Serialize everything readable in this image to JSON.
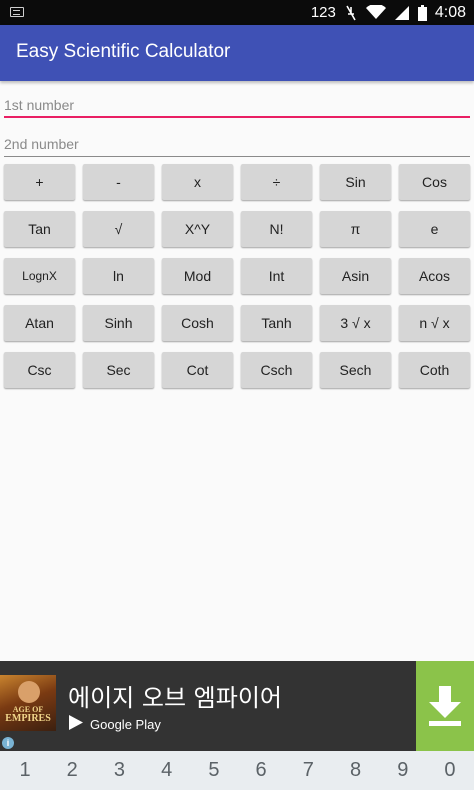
{
  "status_bar": {
    "network_label": "123",
    "clock": "4:08"
  },
  "app_bar": {
    "title": "Easy Scientific Calculator",
    "color": "#3f51b5"
  },
  "inputs": {
    "first": {
      "placeholder": "1st number",
      "value": ""
    },
    "second": {
      "placeholder": "2nd number",
      "value": ""
    },
    "accent": "#e91e63"
  },
  "keys": [
    "+",
    "-",
    "x",
    "÷",
    "Sin",
    "Cos",
    "Tan",
    "√",
    "X^Y",
    "N!",
    "π",
    "e",
    "LognX",
    "ln",
    "Mod",
    "Int",
    "Asin",
    "Acos",
    "Atan",
    "Sinh",
    "Cosh",
    "Tanh",
    "3 √ x",
    "n √ x",
    "Csc",
    "Sec",
    "Cot",
    "Csch",
    "Sech",
    "Coth"
  ],
  "ad": {
    "title": "에이지 오브 엠파이어",
    "store": "Google Play",
    "thumb_line1": "AGE OF",
    "thumb_line2": "EMPIRES",
    "info": "i",
    "download_color": "#8bc34a"
  },
  "number_row": [
    "1",
    "2",
    "3",
    "4",
    "5",
    "6",
    "7",
    "8",
    "9",
    "0"
  ]
}
